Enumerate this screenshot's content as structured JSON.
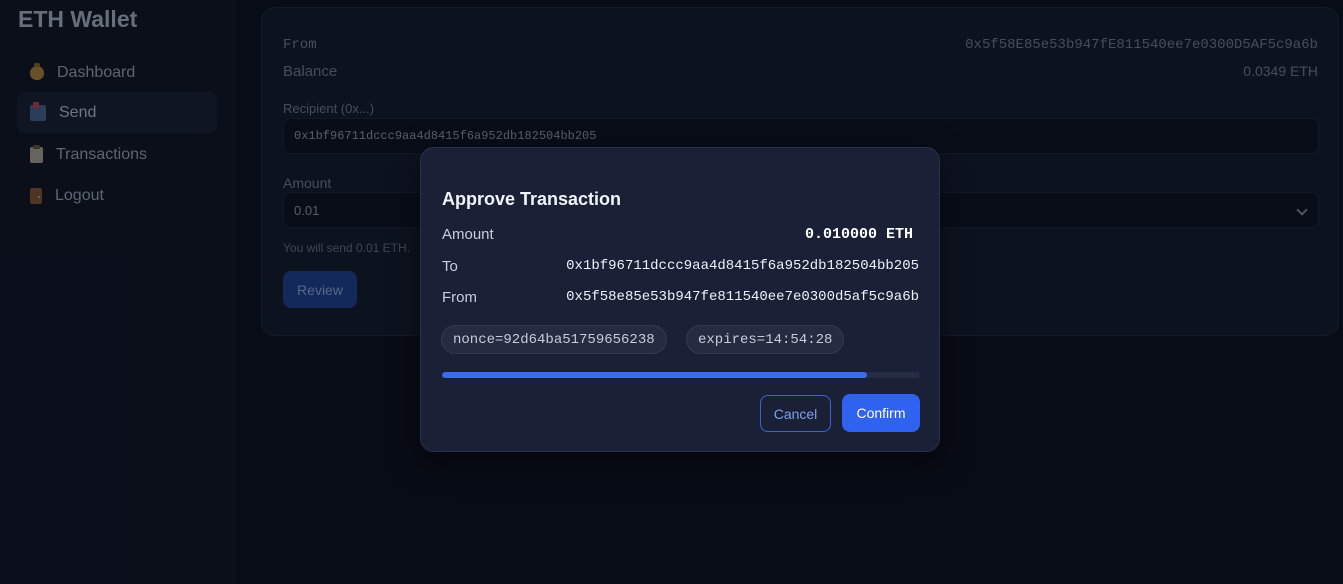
{
  "app": {
    "title": "ETH Wallet"
  },
  "sidebar": {
    "items": [
      {
        "label": "Dashboard",
        "icon": "money-bag-icon"
      },
      {
        "label": "Send",
        "icon": "mailbox-icon",
        "active": true
      },
      {
        "label": "Transactions",
        "icon": "clipboard-icon"
      },
      {
        "label": "Logout",
        "icon": "door-icon"
      }
    ]
  },
  "send_form": {
    "from_label": "From",
    "from_value": "0x5f58E85e53b947fE811540ee7e0300D5AF5c9a6b",
    "balance_label": "Balance",
    "balance_value": "0.0349 ETH",
    "recipient_label": "Recipient (0x...)",
    "recipient_value": "0x1bf96711dccc9aa4d8415f6a952db182504bb205",
    "amount_label": "Amount",
    "amount_value": "0.01",
    "hint": "You will send 0.01 ETH.",
    "review_label": "Review"
  },
  "modal": {
    "title": "Approve Transaction",
    "amount_label": "Amount",
    "amount_value": "0.010000 ETH",
    "to_label": "To",
    "to_value": "0x1bf96711dccc9aa4d8415f6a952db182504bb205",
    "from_label": "From",
    "from_value": "0x5f58e85e53b947fe811540ee7e0300d5af5c9a6b",
    "nonce": "nonce=92d64ba51759656238",
    "expires": "expires=14:54:28",
    "progress_fraction": 0.89,
    "cancel_label": "Cancel",
    "confirm_label": "Confirm"
  },
  "colors": {
    "accent": "#2f62ee",
    "background": "#0b0f1c",
    "card": "#151b2c",
    "modal": "#1a2035"
  }
}
